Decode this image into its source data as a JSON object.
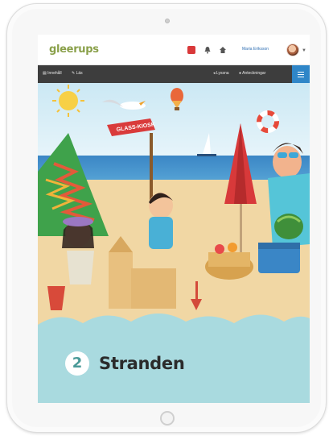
{
  "app": {
    "logo": "gleerups",
    "user_name": "Maria Eriksson"
  },
  "toolbar": {
    "back_label": "Innehåll",
    "read_label": "Läs",
    "listen_label": "Lyssna",
    "notes_label": "Anteckningar"
  },
  "illustration": {
    "sign_text": "GLASS-KIOSK"
  },
  "chapter": {
    "number": "2",
    "title": "Stranden"
  },
  "colors": {
    "accent": "#2f86c8",
    "toolbar": "#3d3d3d",
    "logo_green": "#8aa04a",
    "chapter_bg": "#a9dadf"
  },
  "icons": [
    "camera",
    "home-button",
    "bell-icon",
    "home-icon",
    "menu-icon",
    "avatar"
  ]
}
